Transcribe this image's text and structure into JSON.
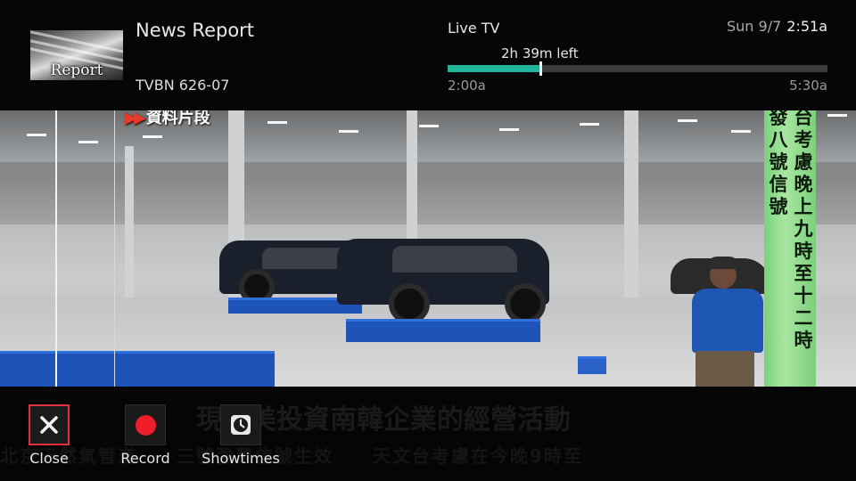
{
  "program": {
    "thumbnail_text": "Report",
    "title": "News Report",
    "channel": "TVBN 626-07"
  },
  "status": {
    "live_label": "Live TV",
    "date": "Sun 9/7",
    "time": "2:51a"
  },
  "progress": {
    "remaining_label": "2h 39m left",
    "start_time": "2:00a",
    "end_time": "5:30a",
    "fraction": 0.243
  },
  "video": {
    "source_tag": "資料片段",
    "vertical_caption_right": "台考慮晚上九時至十二時",
    "vertical_caption_left": "發八號信號"
  },
  "ticker": {
    "headline": "現在美投資南韓企業的經營活動",
    "subline": "北京天然氣管道　　三號強風信號生效　　天文台考慮在今晚9時至"
  },
  "actions": [
    {
      "label": "Close",
      "icon": "close-icon"
    },
    {
      "label": "Record",
      "icon": "record-icon"
    },
    {
      "label": "Showtimes",
      "icon": "clock-icon"
    }
  ],
  "colors": {
    "accent": "#1fb59a",
    "record": "#ef1e2a",
    "focus_border": "#e0313b"
  }
}
